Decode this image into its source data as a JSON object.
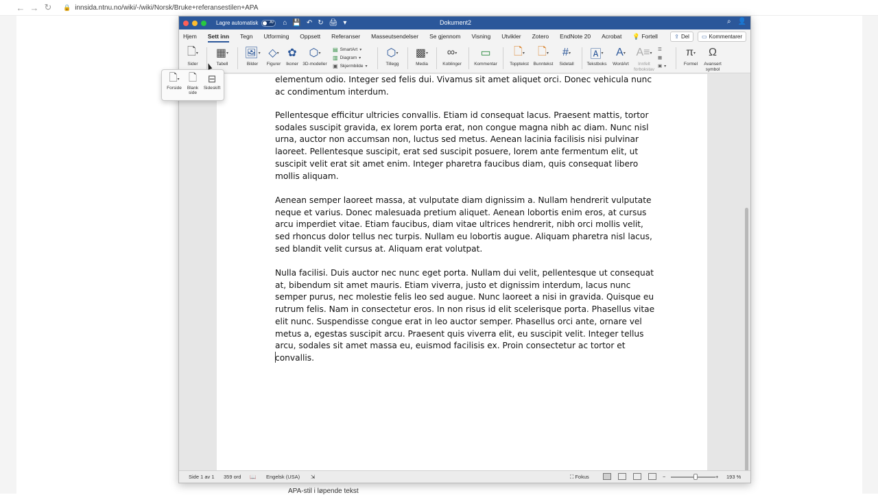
{
  "browser": {
    "back": "←",
    "forward": "→",
    "reload": "↻",
    "lock": "🔒",
    "url": "innsida.ntnu.no/wiki/-/wiki/Norsk/Bruke+referansestilen+APA",
    "below_text": "APA-stil i løpende tekst"
  },
  "titlebar": {
    "autosave_label": "Lagre automatisk",
    "toggle_state": "AV",
    "doc_title": "Dokument2",
    "qat": [
      "⌂",
      "💾",
      "↶",
      "↻",
      "🖨",
      "▾"
    ],
    "search_icon": "⌕",
    "person_icon": "👤"
  },
  "tabs": [
    "Hjem",
    "Sett inn",
    "Tegn",
    "Utforming",
    "Oppsett",
    "Referanser",
    "Masseutsendelser",
    "Se gjennom",
    "Visning",
    "Utvikler",
    "Zotero",
    "EndNote 20",
    "Acrobat",
    "Fortell"
  ],
  "active_tab": "Sett inn",
  "tab_actions": {
    "share": "Del",
    "comments": "Kommentarer"
  },
  "ribbon": {
    "sider": "Sider",
    "tabell": "Tabell",
    "bilder": "Bilder",
    "figurer": "Figurer",
    "ikoner": "Ikoner",
    "modeller": "3D-modeller",
    "smartart": "SmartArt",
    "diagram": "Diagram",
    "skjermbilde": "Skjermbilde",
    "tillegg": "Tillegg",
    "media": "Media",
    "koblinger": "Koblinger",
    "kommentar": "Kommentar",
    "topptekst": "Topptekst",
    "bunntekst": "Bunntekst",
    "sidetall": "Sidetall",
    "tekstboks": "Tekstboks",
    "wordart": "WordArt",
    "innfelt1": "Innfelt",
    "innfelt2": "forbokstav",
    "formel": "Formel",
    "avansert1": "Avansert",
    "avansert2": "symbol"
  },
  "popup": {
    "forside": "Forside",
    "blank1": "Blank",
    "blank2": "side",
    "sideskift": "Sideskift"
  },
  "document": {
    "p0": "elementum odio. Integer sed felis dui. Vivamus sit amet aliquet orci. Donec vehicula nunc ac condimentum interdum.",
    "p1": "Pellentesque efficitur ultricies convallis. Etiam id consequat lacus. Praesent mattis, tortor sodales suscipit gravida, ex lorem porta erat, non congue magna nibh ac diam. Nunc nisl urna, auctor non accumsan non, luctus sed metus. Aenean lacinia facilisis nisi pulvinar laoreet. Pellentesque suscipit, erat sed suscipit posuere, lorem ante fermentum elit, ut suscipit velit erat sit amet enim. Integer pharetra faucibus diam, quis consequat libero mollis aliquam.",
    "p2": "Aenean semper laoreet massa, at vulputate diam dignissim a. Nullam hendrerit vulputate neque et varius. Donec malesuada pretium aliquet. Aenean lobortis enim eros, at cursus arcu imperdiet vitae. Etiam faucibus, diam vitae ultrices hendrerit, nibh orci mollis velit, sed rhoncus dolor tellus nec turpis. Nullam eu lobortis augue. Aliquam pharetra nisl lacus, sed blandit velit cursus at. Aliquam erat volutpat.",
    "p3": "Nulla facilisi. Duis auctor nec nunc eget porta. Nullam dui velit, pellentesque ut consequat at, bibendum sit amet mauris. Etiam viverra, justo et dignissim interdum, lacus nunc semper purus, nec molestie felis leo sed augue. Nunc laoreet a nisi in gravida. Quisque eu rutrum felis. Nam in consectetur eros. In non risus id elit scelerisque porta. Phasellus vitae elit nunc. Suspendisse congue erat in leo auctor semper. Phasellus orci ante, ornare vel metus a, egestas suscipit arcu. Praesent quis viverra elit, eu suscipit velit. Integer tellus arcu, sodales sit amet massa eu, euismod facilisis ex. Proin consectetur ac tortor et convallis."
  },
  "status": {
    "page": "Side 1 av 1",
    "words": "359 ord",
    "language": "Engelsk (USA)",
    "focus": "Fokus",
    "zoom_minus": "−",
    "zoom_plus": "+",
    "zoom_level": "193 %"
  },
  "zoom_percent": 193,
  "accent_color": "#2b579a"
}
